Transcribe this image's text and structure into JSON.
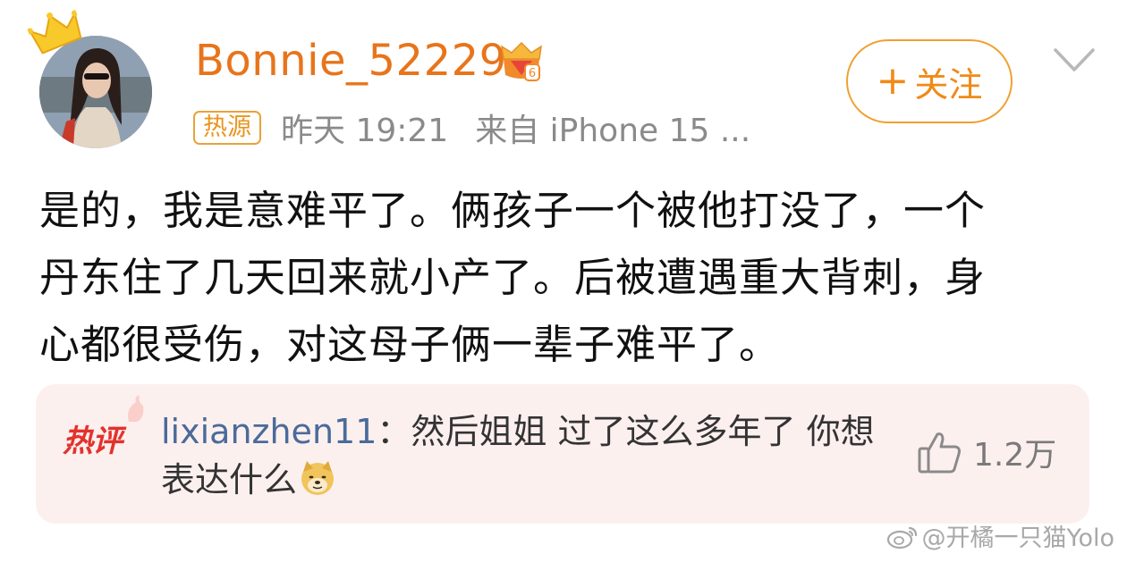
{
  "author": {
    "username": "Bonnie_52229",
    "hot_source_badge": "热源",
    "time": "昨天 19:21",
    "source": "来自 iPhone 15 ..."
  },
  "follow_button": {
    "plus": "+",
    "label": "关注"
  },
  "post": {
    "lines": [
      "是的，我是意难平了。俩孩子一个被他打没了，一个",
      "丹东住了几天回来就小产了。后被遭遇重大背刺，身",
      "心都很受伤，对这母子俩一辈子难平了。"
    ]
  },
  "hot_comment": {
    "badge": "热评",
    "user": "lixianzhen11",
    "separator": "：",
    "text": "然后姐姐 过了这么多年了 你想表达什么",
    "emoji": "doge-icon",
    "likes": "1.2万"
  },
  "watermark": {
    "text": "@开橘一只猫Yolo"
  },
  "colors": {
    "username": "#e8741b",
    "follow_border": "#f0a030",
    "hot_comment_bg": "#fcf0ef",
    "hot_badge": "#e3322c",
    "comment_user": "#4a6b9a",
    "meta_gray": "#8a8a8a"
  }
}
